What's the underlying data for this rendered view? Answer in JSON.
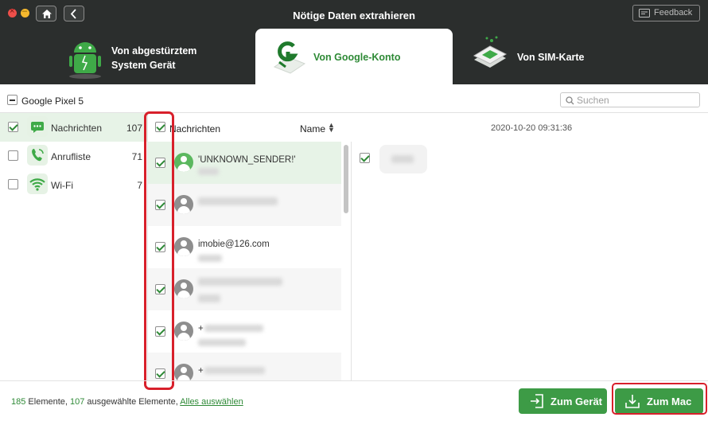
{
  "window": {
    "title": "Nötige Daten extrahieren",
    "feedback_label": "Feedback"
  },
  "tabs": [
    {
      "label_line1": "Von abgestürztem",
      "label_line2": "System Gerät",
      "icon": "android-robot-icon"
    },
    {
      "label": "Von Google-Konto",
      "icon": "google-icon",
      "active": true
    },
    {
      "label": "Von SIM-Karte",
      "icon": "sim-card-icon"
    }
  ],
  "device": {
    "name": "Google Pixel 5"
  },
  "search": {
    "placeholder": "Suchen"
  },
  "categories": [
    {
      "name": "Nachrichten",
      "count": "107",
      "checked": true,
      "active": true
    },
    {
      "name": "Anrufliste",
      "count": "71",
      "checked": false
    },
    {
      "name": "Wi-Fi",
      "count": "7",
      "checked": false
    }
  ],
  "list": {
    "header_title": "Nachrichten",
    "sort_label": "Name",
    "rows": [
      {
        "sender": "'UNKNOWN_SENDER!'",
        "checked": true
      },
      {
        "sender": "",
        "checked": true
      },
      {
        "sender": "imobie@126.com",
        "checked": true
      },
      {
        "sender": "",
        "checked": true
      },
      {
        "sender": "+",
        "checked": true
      },
      {
        "sender": "+",
        "checked": true
      }
    ]
  },
  "detail": {
    "date": "2020-10-20 09:31:36"
  },
  "footer": {
    "total": "185",
    "total_label": " Elemente, ",
    "selected": "107",
    "selected_label": " ausgewählte Elemente, ",
    "select_all": "Alles auswählen",
    "to_device": "Zum Gerät",
    "to_mac": "Zum Mac"
  },
  "colors": {
    "accent": "#3d9b46",
    "header_bg": "#2b2e2d",
    "highlight": "#d8202b"
  }
}
